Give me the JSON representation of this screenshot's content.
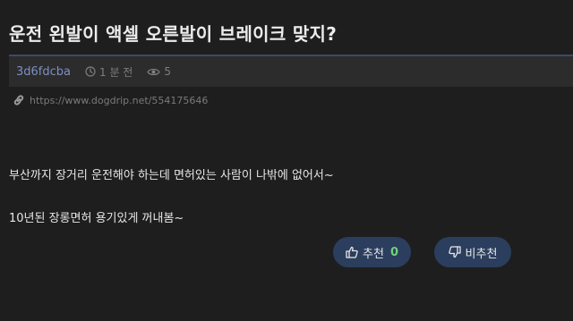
{
  "post": {
    "title": "운전 왼발이 액셀 오른발이 브레이크 맞지?",
    "author": "3d6fdcba",
    "time": "1 분 전",
    "views": "5",
    "url": "https://www.dogdrip.net/554175646",
    "body": [
      "부산까지 장거리 운전해야 하는데 면허있는 사람이 나밖에 없어서~",
      "10년된 장롱면허 용기있게 꺼내봄~"
    ]
  },
  "votes": {
    "up_label": "추천",
    "up_count": "0",
    "down_label": "비추천"
  },
  "colors": {
    "background": "#1e1e1e",
    "meta_bar": "#2c2c2c",
    "author": "#7d8fc4",
    "vote_button": "#2c3e5e",
    "up_count": "#6fd17d"
  },
  "icons": [
    "clock-icon",
    "eye-icon",
    "link-icon",
    "thumbs-up-icon",
    "thumbs-down-icon"
  ]
}
